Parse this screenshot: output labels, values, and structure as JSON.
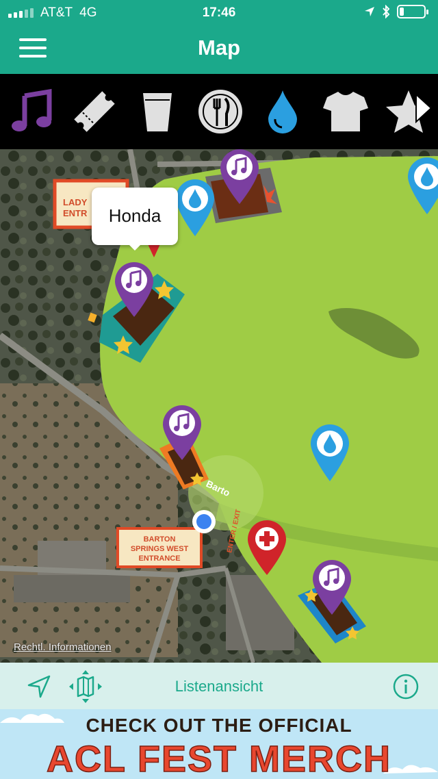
{
  "status_bar": {
    "carrier": "AT&T",
    "network": "4G",
    "time": "17:46",
    "battery_pct": 15
  },
  "header": {
    "title": "Map",
    "bg_color": "#1ba98b"
  },
  "categories": [
    {
      "name": "music",
      "icon": "music-note-icon",
      "color": "#7b3fa0",
      "active": true
    },
    {
      "name": "tickets",
      "icon": "ticket-icon",
      "color": "#e0e0e0"
    },
    {
      "name": "drinks",
      "icon": "cup-icon",
      "color": "#e0e0e0"
    },
    {
      "name": "food",
      "icon": "plate-fork-knife-icon",
      "color": "#e0e0e0"
    },
    {
      "name": "water",
      "icon": "water-drop-icon",
      "color": "#2b9fe0"
    },
    {
      "name": "merch",
      "icon": "tshirt-icon",
      "color": "#e0e0e0"
    },
    {
      "name": "favorites",
      "icon": "star-icon",
      "color": "#e0e0e0"
    }
  ],
  "map": {
    "tooltip": "Honda",
    "signs": {
      "lady_entrance": [
        "LADY",
        "ENTR"
      ],
      "barton_entrance": [
        "BARTON",
        "SPRINGS WEST",
        "ENTRANCE"
      ],
      "enter_exit": "ENTER / EXIT",
      "road_label": "Barto"
    },
    "legal_link": "Rechtl. Informationen"
  },
  "toolbar": {
    "list_view": "Listenansicht"
  },
  "banner": {
    "line1": "CHECK OUT THE OFFICIAL",
    "line2": "ACL FEST MERCH"
  }
}
